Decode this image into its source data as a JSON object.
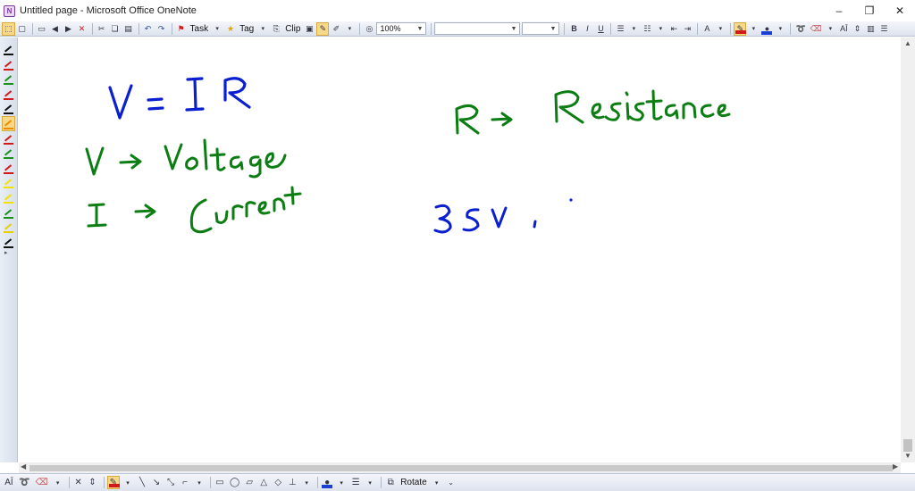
{
  "window": {
    "title": "Untitled page - Microsoft Office OneNote",
    "controls": {
      "minimize": "–",
      "restore": "❐",
      "close": "✕"
    }
  },
  "toolbar": {
    "task_label": "Task",
    "tag_label": "Tag",
    "clip_label": "Clip",
    "zoom_value": "100%",
    "font_name_value": "",
    "font_size_value": "",
    "bold": "B",
    "italic": "I",
    "underline": "U"
  },
  "drawbar": {
    "rotate_label": "Rotate"
  },
  "colors": {
    "ink_blue": "#0a1fcf",
    "ink_green": "#0b7d12",
    "highlight": "#f8d98a",
    "chrome": "#dde3ee"
  },
  "pen_palette": [
    {
      "icon": "pen-black-icon",
      "color": "#111111"
    },
    {
      "icon": "pen-red-icon",
      "color": "#d21a1a"
    },
    {
      "icon": "pen-green-icon",
      "color": "#1a8f1a"
    },
    {
      "icon": "pen-red-icon",
      "color": "#d21a1a"
    },
    {
      "icon": "pen-black-icon",
      "color": "#111111"
    },
    {
      "icon": "pen-orange-icon",
      "color": "#f08a00"
    },
    {
      "icon": "pen-red-icon",
      "color": "#d21a1a"
    },
    {
      "icon": "pen-green-icon",
      "color": "#1a8f1a"
    },
    {
      "icon": "pen-red-icon",
      "color": "#d21a1a"
    },
    {
      "icon": "pen-yellow-icon",
      "color": "#f2e200"
    },
    {
      "icon": "pen-yellow-icon",
      "color": "#f2e200"
    },
    {
      "icon": "pen-green-icon",
      "color": "#1a8f1a"
    },
    {
      "icon": "pen-yellow-icon",
      "color": "#e6d000"
    },
    {
      "icon": "pen-black-icon",
      "color": "#111111"
    }
  ]
}
